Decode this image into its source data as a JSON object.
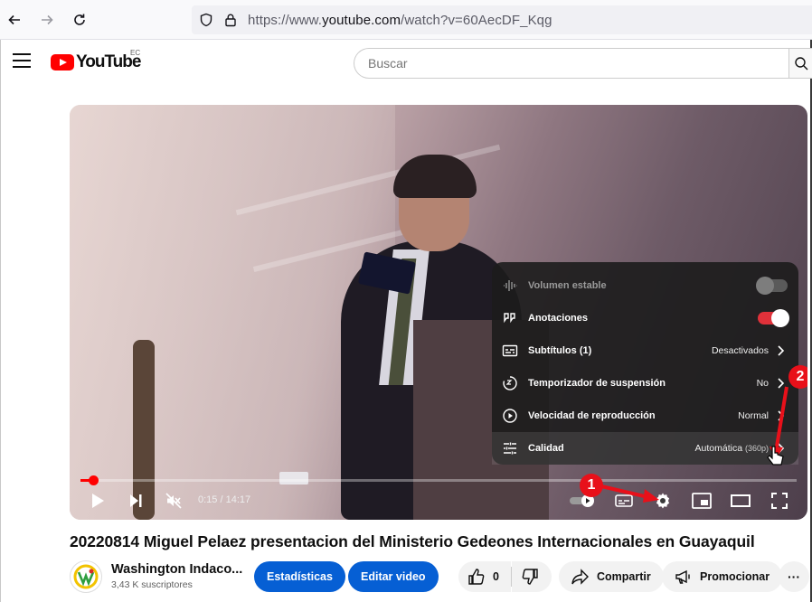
{
  "browser": {
    "url_prefix": "https://www.",
    "url_domain": "youtube.com",
    "url_path": "/watch?v=60AecDF_Kqg"
  },
  "header": {
    "logo_text": "YouTube",
    "country_code": "EC",
    "search_placeholder": "Buscar"
  },
  "player": {
    "time_current": "0:15",
    "time_total": "14:17",
    "time_display": "0:15 / 14:17",
    "progress": 0.0175,
    "settings": [
      {
        "label": "Volumen estable",
        "value": "",
        "icon": "stable-volume-icon",
        "control": "toggle-off",
        "disabled": true
      },
      {
        "label": "Anotaciones",
        "value": "",
        "icon": "annotations-icon",
        "control": "toggle-on",
        "disabled": false
      },
      {
        "label": "Subtítulos (1)",
        "value": "Desactivados",
        "icon": "subtitles-icon",
        "control": "chevron",
        "disabled": false
      },
      {
        "label": "Temporizador de suspensión",
        "value": "No",
        "icon": "sleep-timer-icon",
        "control": "chevron",
        "disabled": false
      },
      {
        "label": "Velocidad de reproducción",
        "value": "Normal",
        "icon": "playback-speed-icon",
        "control": "chevron",
        "disabled": false
      },
      {
        "label": "Calidad",
        "value": "Automática",
        "value_detail": "(360p)",
        "icon": "quality-icon",
        "control": "chevron",
        "disabled": false
      }
    ],
    "markers": [
      "1",
      "2"
    ]
  },
  "video": {
    "title": "20220814 Miguel Pelaez presentacion del Ministerio Gedeones Internacionales en Guayaquil",
    "channel_name": "Washington Indaco...",
    "subscribers": "3,43 K suscriptores",
    "stats_button": "Estadísticas",
    "edit_button": "Editar video",
    "likes": "0",
    "share_button": "Compartir",
    "promote_button": "Promocionar",
    "more_button": "···"
  },
  "colors": {
    "brand_red": "#ff0000",
    "action_blue": "#065fd4",
    "marker_red": "#e8101a"
  }
}
